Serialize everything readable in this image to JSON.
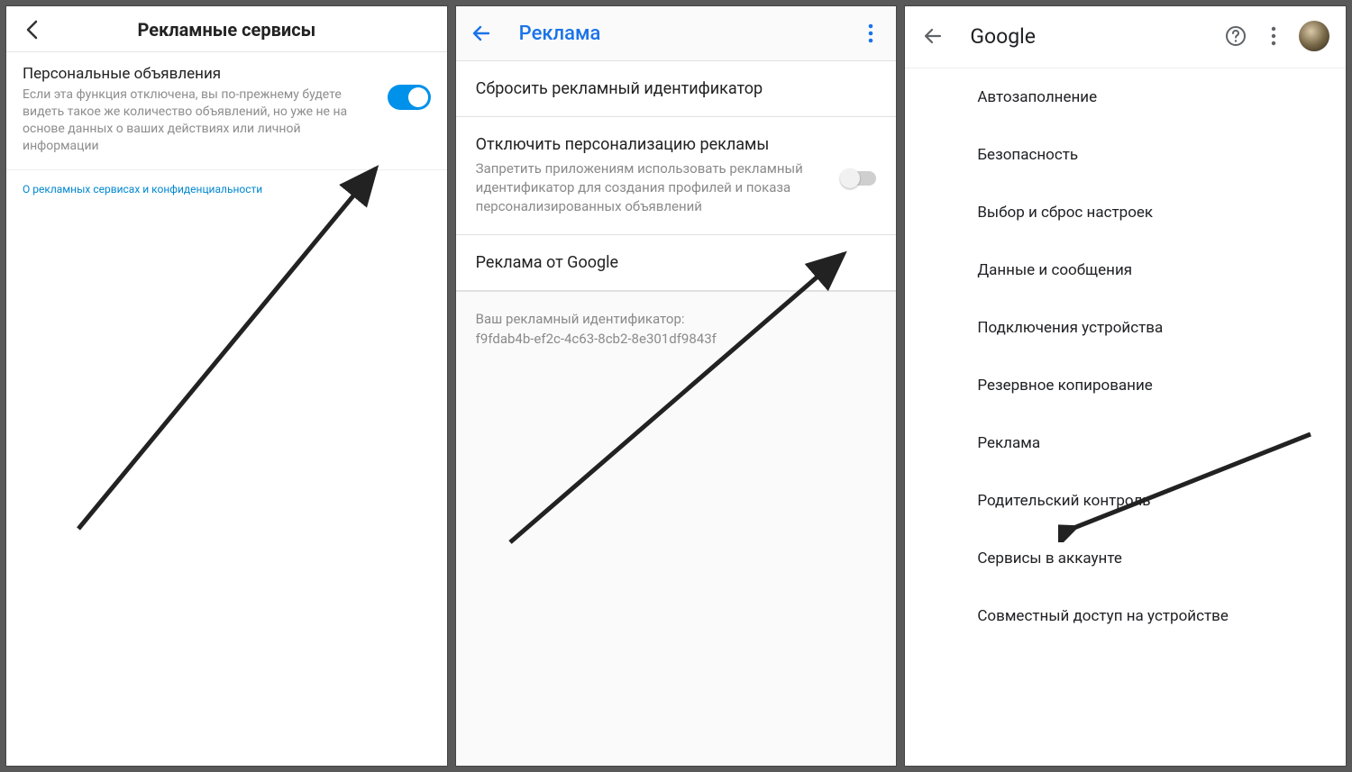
{
  "screen1": {
    "header_title": "Рекламные сервисы",
    "toggle_row": {
      "title": "Персональные объявления",
      "desc": "Если эта функция отключена, вы по-прежнему будете видеть такое же количество объявлений, но уже не на основе данных о ваших действиях или личной информации"
    },
    "link_text": "О рекламных сервисах и конфиденциальности"
  },
  "screen2": {
    "header_title": "Реклама",
    "reset_row": "Сбросить рекламный идентификатор",
    "optout_row": {
      "title": "Отключить персонализацию рекламы",
      "desc": "Запретить приложениям использовать рекламный идентификатор для создания профилей и показа персонализированных объявлений"
    },
    "google_ads_row": "Реклама от Google",
    "ad_id_label": "Ваш рекламный идентификатор:",
    "ad_id_value": "f9fdab4b-ef2c-4c63-8cb2-8e301df9843f"
  },
  "screen3": {
    "header_title": "Google",
    "items": [
      "Автозаполнение",
      "Безопасность",
      "Выбор и сброс настроек",
      "Данные и сообщения",
      "Подключения устройства",
      "Резервное копирование",
      "Реклама",
      "Родительский контроль",
      "Сервисы в аккаунте",
      "Совместный доступ на устройстве"
    ]
  }
}
